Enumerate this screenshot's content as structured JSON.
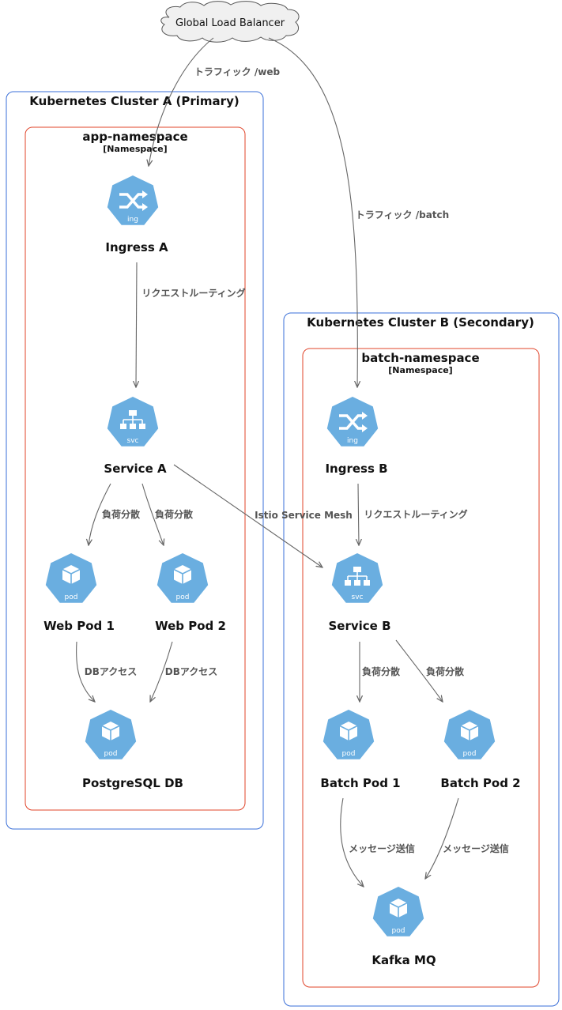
{
  "load_balancer": {
    "label": "Global Load Balancer"
  },
  "clusters": [
    {
      "id": "a",
      "title": "Kubernetes Cluster A (Primary)"
    },
    {
      "id": "b",
      "title": "Kubernetes Cluster B (Secondary)"
    }
  ],
  "namespaces": [
    {
      "id": "app",
      "title": "app-namespace",
      "subtitle": "[Namespace]"
    },
    {
      "id": "batch",
      "title": "batch-namespace",
      "subtitle": "[Namespace]"
    }
  ],
  "nodes": {
    "ingress_a": {
      "label": "Ingress A",
      "icon": "ingress-icon",
      "icon_text": "ing"
    },
    "service_a": {
      "label": "Service A",
      "icon": "service-icon",
      "icon_text": "svc"
    },
    "web_pod_1": {
      "label": "Web Pod 1",
      "icon": "pod-icon",
      "icon_text": "pod"
    },
    "web_pod_2": {
      "label": "Web Pod 2",
      "icon": "pod-icon",
      "icon_text": "pod"
    },
    "postgres_db": {
      "label": "PostgreSQL DB",
      "icon": "pod-icon",
      "icon_text": "pod"
    },
    "ingress_b": {
      "label": "Ingress B",
      "icon": "ingress-icon",
      "icon_text": "ing"
    },
    "service_b": {
      "label": "Service B",
      "icon": "service-icon",
      "icon_text": "svc"
    },
    "batch_pod_1": {
      "label": "Batch Pod 1",
      "icon": "pod-icon",
      "icon_text": "pod"
    },
    "batch_pod_2": {
      "label": "Batch Pod 2",
      "icon": "pod-icon",
      "icon_text": "pod"
    },
    "kafka_mq": {
      "label": "Kafka MQ",
      "icon": "pod-icon",
      "icon_text": "pod"
    }
  },
  "edges": {
    "lb_to_ingress_a": {
      "label": "トラフィック /web"
    },
    "lb_to_ingress_b": {
      "label": "トラフィック /batch"
    },
    "ingress_a_to_service_a": {
      "label": "リクエストルーティング"
    },
    "service_a_to_web_pod_1": {
      "label": "負荷分散"
    },
    "service_a_to_web_pod_2": {
      "label": "負荷分散"
    },
    "web_pod_1_to_db": {
      "label": "DBアクセス"
    },
    "web_pod_2_to_db": {
      "label": "DBアクセス"
    },
    "service_a_to_service_b": {
      "label": "Istio Service Mesh"
    },
    "ingress_b_to_service_b": {
      "label": "リクエストルーティング"
    },
    "service_b_to_batch_pod_1": {
      "label": "負荷分散"
    },
    "service_b_to_batch_pod_2": {
      "label": "負荷分散"
    },
    "batch_pod_1_to_kafka": {
      "label": "メッセージ送信"
    },
    "batch_pod_2_to_kafka": {
      "label": "メッセージ送信"
    }
  },
  "colors": {
    "cluster_border": "#3a6fd8",
    "namespace_border": "#e0442a",
    "icon_fill": "#6aaee0",
    "edge": "#666666"
  }
}
